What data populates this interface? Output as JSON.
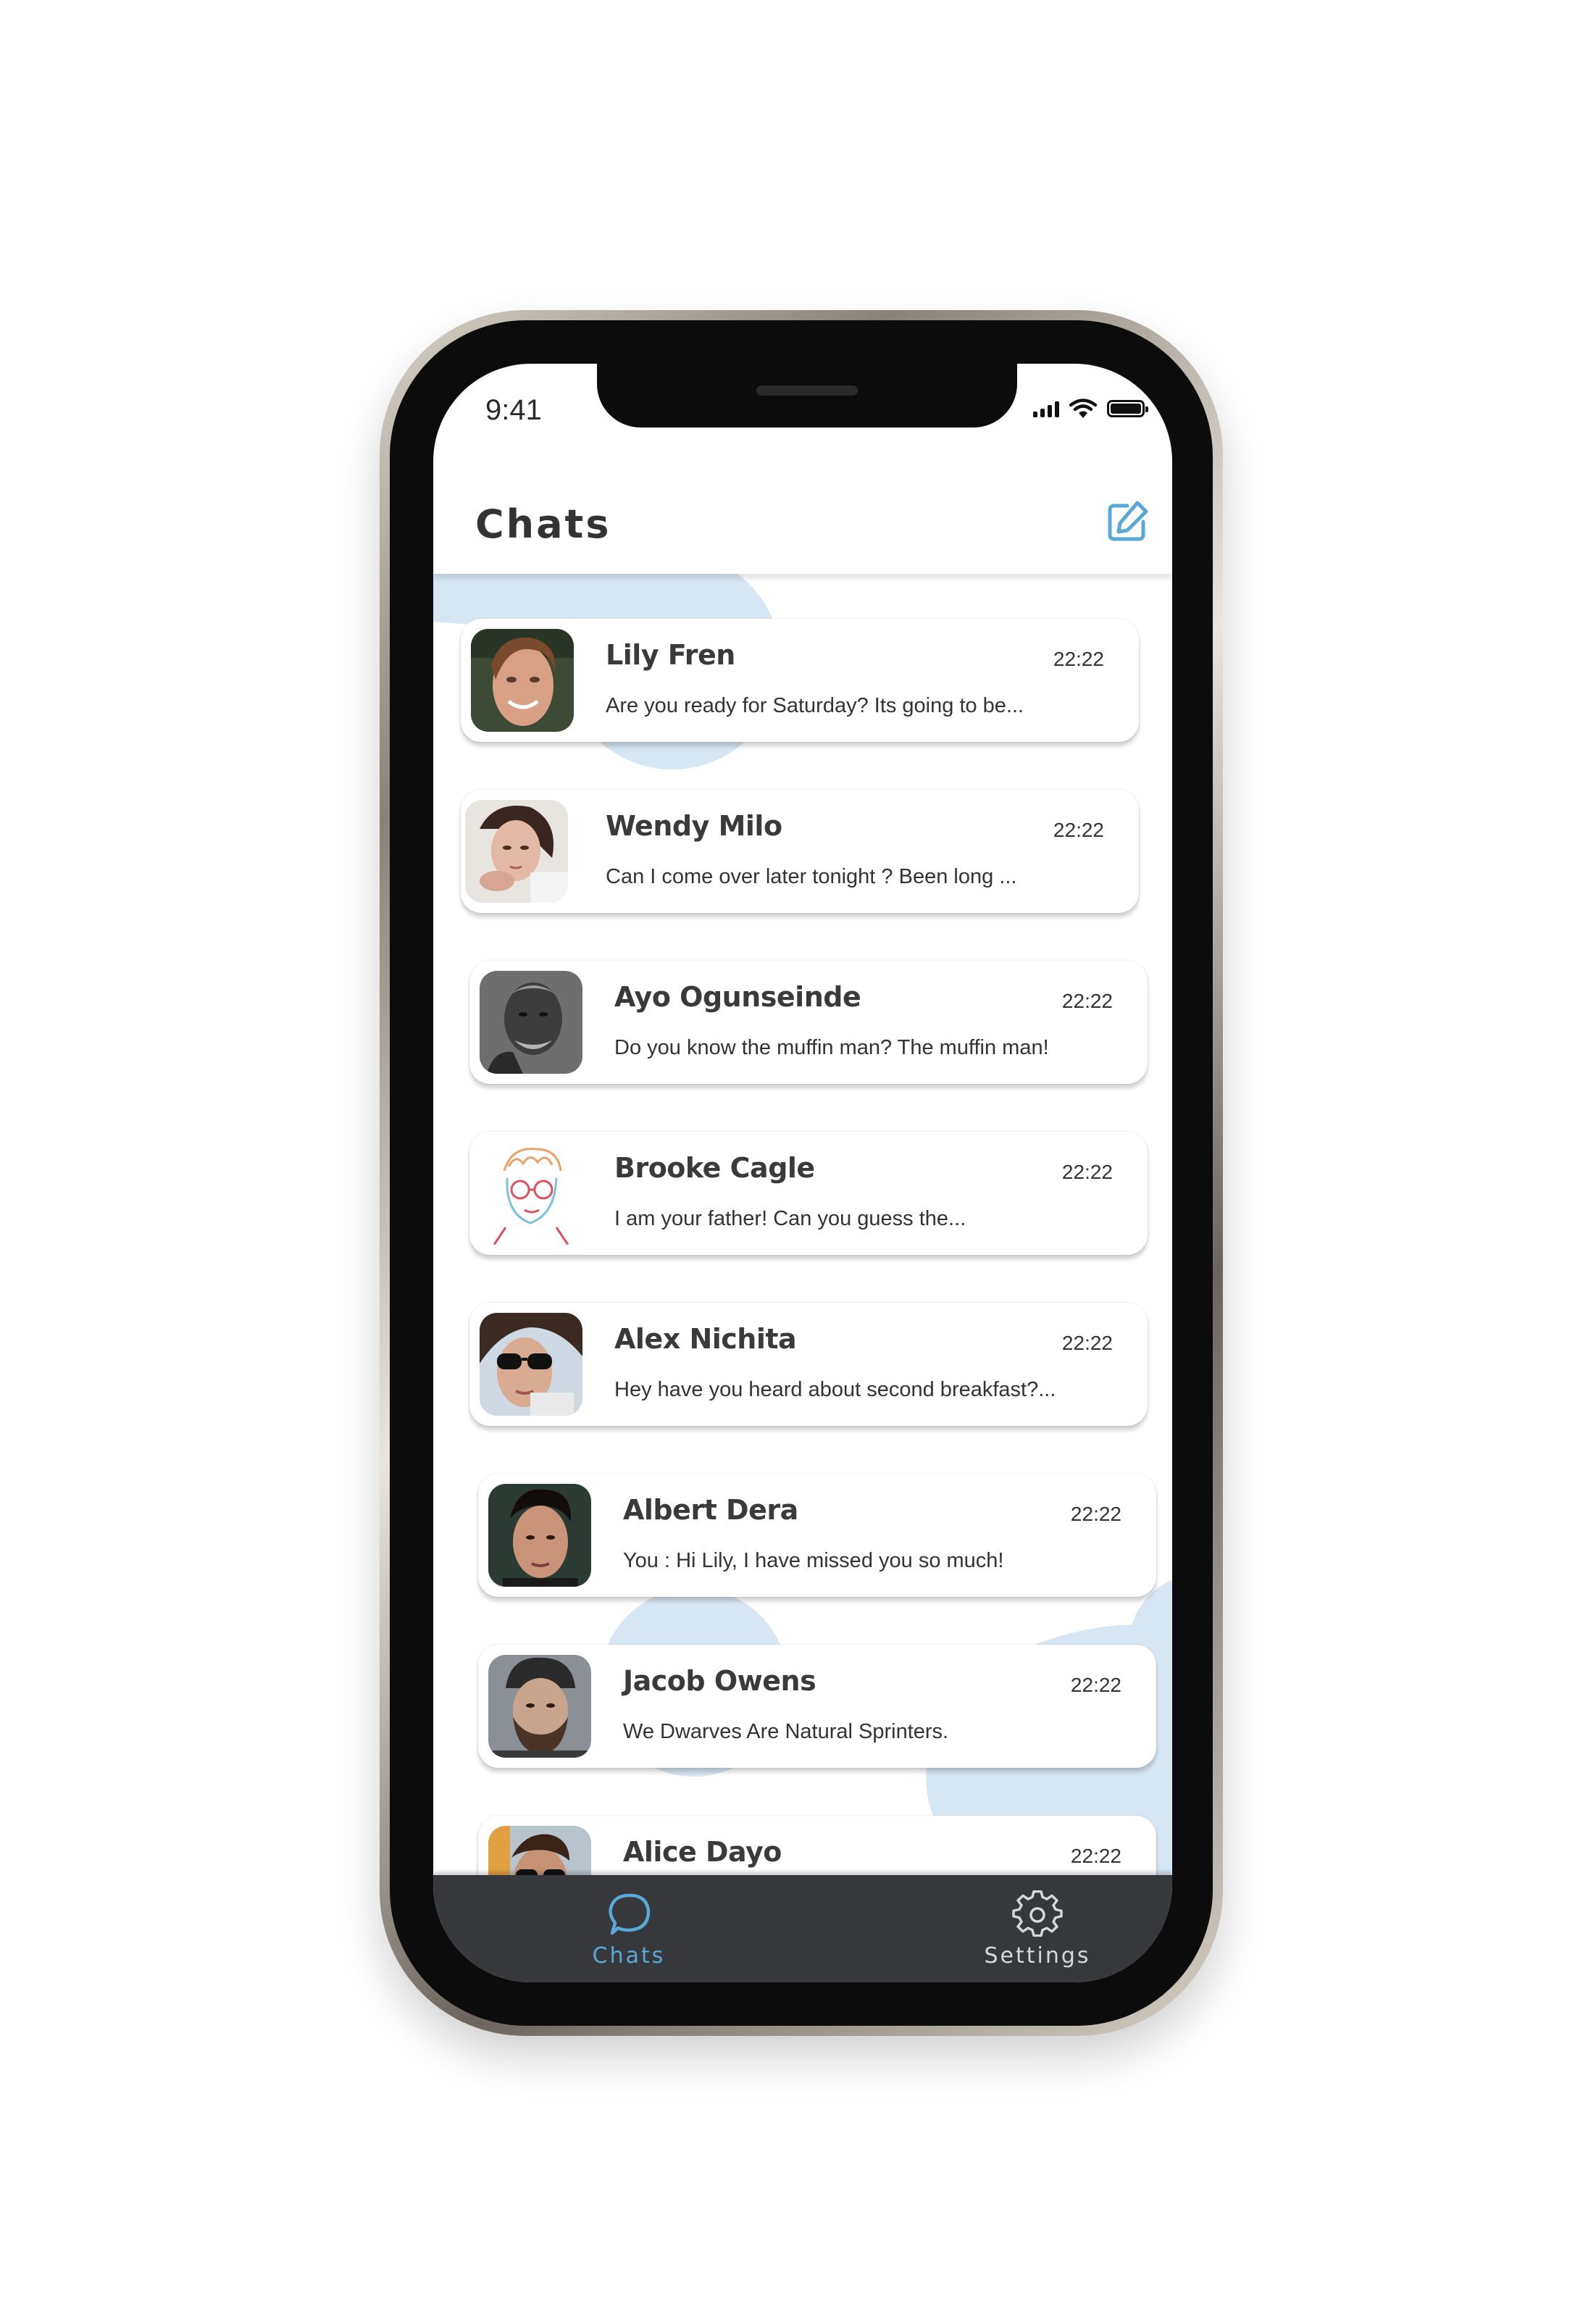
{
  "status_bar": {
    "time": "9:41"
  },
  "header": {
    "title": "Chats",
    "compose_icon": "edit-icon",
    "accent": "#5aa8d6"
  },
  "chats": [
    {
      "name": "Lily Fren",
      "time": "22:22",
      "preview": "Are you ready for Saturday? Its going to be..."
    },
    {
      "name": "Wendy Milo",
      "time": "22:22",
      "preview": "Can I come over later tonight ? Been long ..."
    },
    {
      "name": "Ayo Ogunseinde",
      "time": "22:22",
      "preview": "Do you know the muffin man? The muffin man!"
    },
    {
      "name": "Brooke Cagle",
      "time": "22:22",
      "preview": "I am your father! Can you guess the..."
    },
    {
      "name": "Alex Nichita",
      "time": "22:22",
      "preview": "Hey have you heard about second breakfast?..."
    },
    {
      "name": "Albert Dera",
      "time": "22:22",
      "preview": "You : Hi Lily, I have missed you so much!"
    },
    {
      "name": "Jacob Owens",
      "time": "22:22",
      "preview": "We Dwarves Are Natural Sprinters."
    },
    {
      "name": "Alice Dayo",
      "time": "22:22",
      "preview": ""
    }
  ],
  "tabbar": {
    "tabs": [
      {
        "label": "Chats",
        "icon": "chat-bubble-icon",
        "active": true
      },
      {
        "label": "Settings",
        "icon": "gear-icon",
        "active": false
      }
    ],
    "active_color": "#5aa8d6",
    "inactive_color": "#d8d8d8"
  }
}
